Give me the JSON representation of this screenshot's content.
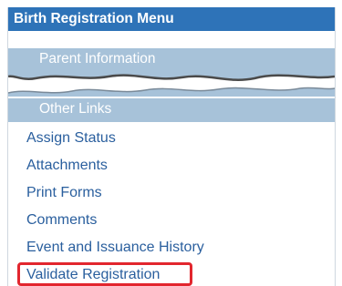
{
  "menu": {
    "title": "Birth Registration Menu",
    "sections": {
      "parent_information": "Parent Information",
      "other_links": "Other Links"
    },
    "links": [
      "Assign Status",
      "Attachments",
      "Print Forms",
      "Comments",
      "Event and Issuance History",
      "Validate Registration"
    ],
    "highlighted_link": "Validate Registration"
  },
  "colors": {
    "header_bg": "#2e73b8",
    "section_bg": "#a7c2d9",
    "link_text": "#2a5f9e",
    "highlight_border": "#e2262e"
  }
}
